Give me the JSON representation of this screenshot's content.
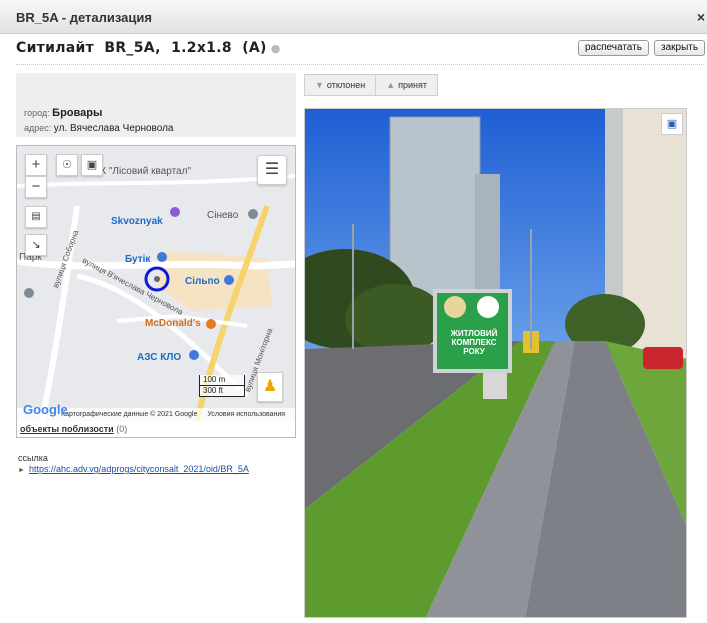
{
  "window": {
    "title": "BR_5A - детализация",
    "close_glyph": "×"
  },
  "header": {
    "title": "Ситилайт  BR_5A,  1.2x1.8  (A)",
    "pin_icon": "pin-icon",
    "print_label": "распечатать",
    "close_label": "закрыть"
  },
  "info": {
    "city_label": "город:",
    "city_value": "Бровары",
    "address_label": "адрес:",
    "address_value": "ул. Вячеслава Черновола"
  },
  "map": {
    "zoom_in": "+",
    "zoom_out": "−",
    "labels": {
      "complex": "ЖК \"Лісовий квартал\"",
      "skvoznyak": "Skvoznyak",
      "sineve": "Сінево",
      "butik": "Бутік",
      "silpo": "Сільпо",
      "mcdonalds": "McDonald's",
      "azs": "АЗС КЛО",
      "park": "Парк",
      "street1": "вулиця Соборна",
      "street2": "вулиця В'ячеслава Черновола",
      "street3": "вулиця Моніторна"
    },
    "scale_m": "100 m",
    "scale_ft": "300 ft",
    "google_logo": "Google",
    "attribution": "Картографические данные © 2021 Google",
    "terms": "Условия использования",
    "nearby_label": "объекты поблизости",
    "nearby_count": "(0)"
  },
  "link": {
    "label": "ссылка",
    "url": "https://ahc.adv.vg/adprogs/cityconsalt_2021/oid/BR_5A"
  },
  "status": {
    "rejected": "отклонен",
    "accepted": "принят"
  },
  "photo": {
    "billboard_line1": "ЖИТЛОВИЙ",
    "billboard_line2": "КОМПЛЕКС",
    "billboard_line3": "РОКУ"
  }
}
